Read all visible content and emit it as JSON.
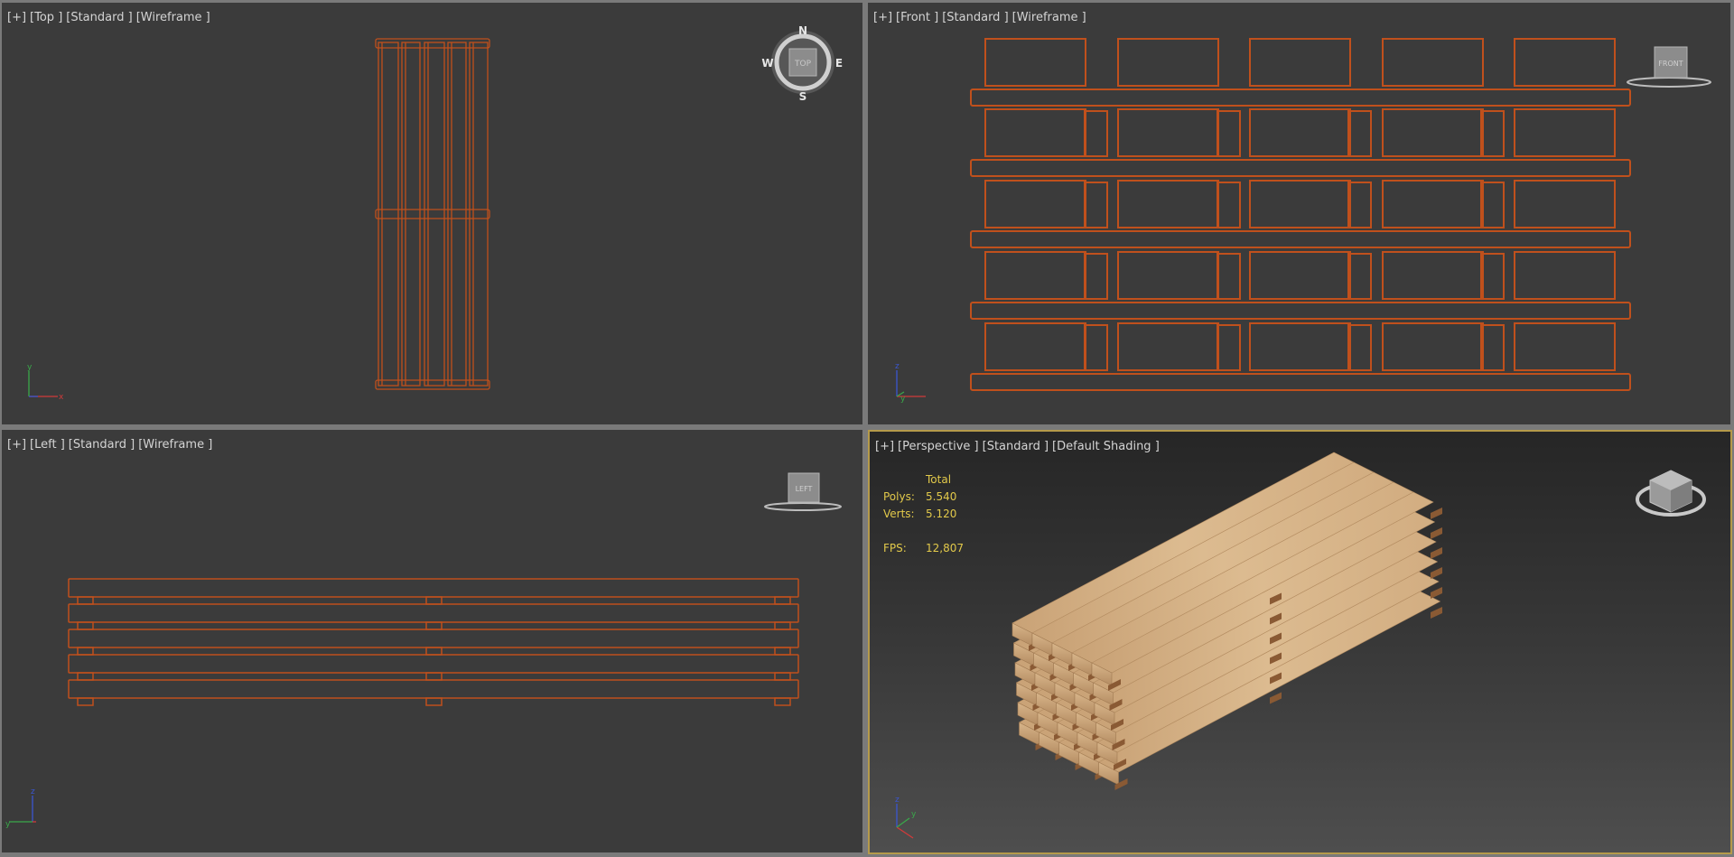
{
  "viewports": {
    "top": {
      "labels": [
        "[+]",
        "[Top ]",
        "[Standard ]",
        "[Wireframe ]"
      ],
      "cube_face": "TOP",
      "compass": {
        "n": "N",
        "s": "S",
        "e": "E",
        "w": "W"
      }
    },
    "front": {
      "labels": [
        "[+]",
        "[Front ]",
        "[Standard ]",
        "[Wireframe ]"
      ],
      "cube_face": "FRONT"
    },
    "left": {
      "labels": [
        "[+]",
        "[Left ]",
        "[Standard ]",
        "[Wireframe ]"
      ],
      "cube_face": "LEFT"
    },
    "perspective": {
      "labels": [
        "[+]",
        "[Perspective ]",
        "[Standard ]",
        "[Default Shading ]"
      ]
    }
  },
  "stats": {
    "total": "Total",
    "polys_label": "Polys:",
    "polys": "5.540",
    "verts_label": "Verts:",
    "verts": "5.120",
    "fps_label": "FPS:",
    "fps": "12,807"
  },
  "colors": {
    "wireframe": "#c0501c",
    "viewport_bg": "#3b3b3b",
    "active_border": "#b59a4a",
    "stats_text": "#e2c94a",
    "wood": "#d4b083",
    "wood_dark": "#8a5a34"
  },
  "icons": [
    "view-cube-icon",
    "compass-ring-icon",
    "axis-tripod-icon"
  ]
}
